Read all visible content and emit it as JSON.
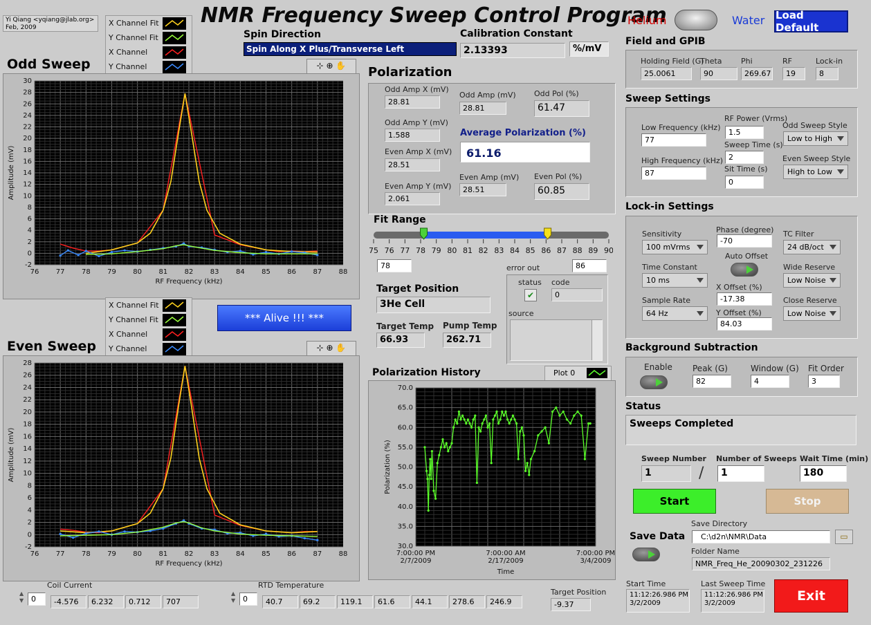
{
  "app": {
    "title": "NMR Frequency Sweep Control Program",
    "author_line1": "Yi Qiang <yqiang@jlab.org>",
    "author_line2": "Feb, 2009",
    "helium_label": "Helium",
    "water_label": "Water",
    "load_default": "Load Default"
  },
  "spin": {
    "label": "Spin Direction",
    "value": "Spin Along X Plus/Transverse Left"
  },
  "calibration": {
    "label": "Calibration Constant",
    "value": "2.13393",
    "unit": "%/mV"
  },
  "odd_sweep": {
    "title": "Odd Sweep",
    "legend": [
      "X Channel Fit",
      "Y Channel Fit",
      "X Channel",
      "Y Channel"
    ],
    "xlabel": "RF Frequency (kHz)",
    "ylabel": "Amplitude (mV)",
    "ticks_x": [
      "76",
      "77",
      "78",
      "79",
      "80",
      "81",
      "82",
      "83",
      "84",
      "85",
      "86",
      "87",
      "88"
    ],
    "ticks_y": [
      "30",
      "28",
      "26",
      "24",
      "22",
      "20",
      "18",
      "16",
      "14",
      "12",
      "10",
      "8",
      "6",
      "4",
      "2",
      "0",
      "-2"
    ]
  },
  "even_sweep": {
    "title": "Even Sweep",
    "legend": [
      "X Channel Fit",
      "Y Channel Fit",
      "X Channel",
      "Y Channel"
    ],
    "xlabel": "RF Frequency (kHz)",
    "ylabel": "Amplitude (mV)",
    "ticks_x": [
      "76",
      "77",
      "78",
      "79",
      "80",
      "81",
      "82",
      "83",
      "84",
      "85",
      "86",
      "87",
      "88"
    ],
    "ticks_y": [
      "28",
      "26",
      "24",
      "22",
      "20",
      "18",
      "16",
      "14",
      "12",
      "10",
      "8",
      "6",
      "4",
      "2",
      "0",
      "-2"
    ]
  },
  "alive": "*** Alive !!! ***",
  "polarization": {
    "title": "Polarization",
    "odd_amp_x_label": "Odd Amp X (mV)",
    "odd_amp_x": "28.81",
    "odd_amp_y_label": "Odd Amp Y (mV)",
    "odd_amp_y": "1.588",
    "even_amp_x_label": "Even Amp X (mV)",
    "even_amp_x": "28.51",
    "even_amp_y_label": "Even Amp Y (mV)",
    "even_amp_y": "2.061",
    "odd_amp_label": "Odd Amp (mV)",
    "odd_amp": "28.81",
    "even_amp_label": "Even Amp (mV)",
    "even_amp": "28.51",
    "odd_pol_label": "Odd Pol (%)",
    "odd_pol": "61.47",
    "even_pol_label": "Even Pol (%)",
    "even_pol": "60.85",
    "avg_label": "Average Polarization (%)",
    "avg": "61.16"
  },
  "fit_range": {
    "label": "Fit Range",
    "ticks": [
      "75",
      "76",
      "77",
      "78",
      "79",
      "80",
      "81",
      "82",
      "83",
      "84",
      "85",
      "86",
      "87",
      "88",
      "89",
      "90"
    ],
    "low": "78",
    "high": "86",
    "low_value": 78.2,
    "high_value": 86.1,
    "min": 75,
    "max": 90
  },
  "error_out": {
    "label": "error out",
    "status_label": "status",
    "code_label": "code",
    "code": "0",
    "source_label": "source",
    "check": "✔"
  },
  "target": {
    "position_label": "Target Position",
    "position": "3He Cell",
    "temp_label": "Target Temp",
    "temp": "66.93",
    "pump_label": "Pump Temp",
    "pump": "262.71"
  },
  "history": {
    "title": "Polarization History",
    "plot_label": "Plot 0",
    "xlabel": "Time",
    "ylabel": "Polarization (%)",
    "ticks_y": [
      "70.0",
      "65.0",
      "60.0",
      "55.0",
      "50.0",
      "45.0",
      "40.0",
      "35.0",
      "30.0"
    ],
    "ticks_x": [
      [
        "7:00:00 PM",
        "2/7/2009"
      ],
      [
        "7:00:00 AM",
        "2/17/2009"
      ],
      [
        "7:00:00 PM",
        "3/4/2009"
      ]
    ]
  },
  "field": {
    "title": "Field and GPIB",
    "holding_label": "Holding Field (G)",
    "holding": "25.0061",
    "theta_label": "Theta",
    "theta": "90",
    "phi_label": "Phi",
    "phi": "269.67",
    "rf_label": "RF",
    "rf": "19",
    "lockin_label": "Lock-in",
    "lockin": "8"
  },
  "sweep_settings": {
    "title": "Sweep Settings",
    "low_label": "Low Frequency (kHz)",
    "low": "77",
    "high_label": "High Frequency (kHz)",
    "high": "87",
    "rf_power_label": "RF Power (Vrms)",
    "rf_power": "1.5",
    "sweep_time_label": "Sweep Time (s)",
    "sweep_time": "2",
    "sit_time_label": "Sit Time (s)",
    "sit_time": "0",
    "odd_style_label": "Odd Sweep Style",
    "odd_style": "Low to High",
    "even_style_label": "Even Sweep Style",
    "even_style": "High to Low"
  },
  "lockin": {
    "title": "Lock-in Settings",
    "sensitivity_label": "Sensitivity",
    "sensitivity": "100 mVrms",
    "time_constant_label": "Time Constant",
    "time_constant": "10 ms",
    "sample_rate_label": "Sample Rate",
    "sample_rate": "64 Hz",
    "phase_label": "Phase (degree)",
    "phase": "-70",
    "auto_offset_label": "Auto Offset",
    "x_offset_label": "X Offset (%)",
    "x_offset": "-17.38",
    "y_offset_label": "Y Offset (%)",
    "y_offset": "84.03",
    "tc_filter_label": "TC Filter",
    "tc_filter": "24 dB/oct",
    "wide_label": "Wide Reserve",
    "wide": "Low Noise",
    "close_label": "Close Reserve",
    "close": "Low Noise"
  },
  "background": {
    "title": "Background Subtraction",
    "enable_label": "Enable",
    "peak_label": "Peak (G)",
    "peak": "82",
    "window_label": "Window (G)",
    "window": "4",
    "fit_order_label": "Fit Order",
    "fit_order": "3"
  },
  "status": {
    "title": "Status",
    "value": "Sweeps Completed"
  },
  "sweeps": {
    "number_label": "Sweep Number",
    "number": "1",
    "count_label": "Number of Sweeps",
    "count": "1",
    "wait_label": "Wait Time (min)",
    "wait": "180",
    "slash": "/"
  },
  "buttons": {
    "start": "Start",
    "stop": "Stop",
    "exit": "Exit"
  },
  "save": {
    "label": "Save Data",
    "dir_label": "Save Directory",
    "dir": "C:\\d2n\\NMR\\Data",
    "folder_label": "Folder Name",
    "folder": "NMR_Freq_He_20090302_231226"
  },
  "times": {
    "start_label": "Start Time",
    "start1": "11:12:26.986 PM",
    "start2": "3/2/2009",
    "last_label": "Last Sweep Time",
    "last1": "11:12:26.986 PM",
    "last2": "3/2/2009"
  },
  "coil": {
    "label": "Coil Current",
    "index": "0",
    "values": [
      "-4.576",
      "6.232",
      "0.712",
      "707"
    ]
  },
  "rtd": {
    "label": "RTD Temperature",
    "index": "0",
    "values": [
      "40.7",
      "69.2",
      "119.1",
      "61.6",
      "44.1",
      "278.6",
      "246.9"
    ]
  },
  "target_position": {
    "label": "Target Position",
    "value": "-9.37"
  },
  "colors": {
    "x_fit": "#ffd21e",
    "y_fit": "#9aff3c",
    "x_ch": "#ff2020",
    "y_ch": "#3a8bff",
    "history": "#5bff2a"
  },
  "chart_data": [
    {
      "type": "line",
      "title": "Odd Sweep",
      "xlabel": "RF Frequency (kHz)",
      "ylabel": "Amplitude (mV)",
      "xlim": [
        76,
        88
      ],
      "ylim": [
        -2,
        30
      ],
      "series": [
        {
          "name": "X Channel Fit",
          "x": [
            78,
            79,
            80,
            80.5,
            81,
            81.3,
            81.6,
            81.85,
            82.1,
            82.4,
            82.7,
            83.2,
            84,
            85,
            86,
            87
          ],
          "y": [
            0,
            0.6,
            1.8,
            3.5,
            7.5,
            12.5,
            21,
            27.8,
            21,
            12.5,
            7.5,
            3.5,
            1.6,
            0.6,
            0.3,
            0.2
          ]
        },
        {
          "name": "Y Channel Fit",
          "x": [
            78,
            79,
            80,
            81,
            81.5,
            81.8,
            82,
            82.5,
            83,
            84,
            85,
            86,
            87
          ],
          "y": [
            -0.2,
            -0.1,
            0.3,
            0.8,
            1.3,
            1.5,
            1.3,
            0.9,
            0.5,
            0.1,
            -0.1,
            -0.1,
            -0.1
          ]
        },
        {
          "name": "X Channel",
          "x": [
            77,
            77.5,
            78,
            78.5,
            79,
            80,
            81,
            81.85,
            83,
            84,
            85,
            85.5,
            86,
            86.5,
            87
          ],
          "y": [
            1.6,
            0.9,
            0.4,
            0.4,
            0.6,
            1.8,
            7.5,
            27.8,
            3.2,
            1.5,
            0.6,
            0.3,
            0.4,
            0.3,
            0.4
          ]
        },
        {
          "name": "Y Channel",
          "x": [
            77,
            77.3,
            77.7,
            78,
            78.5,
            79,
            79.5,
            80,
            80.5,
            81,
            81.5,
            81.8,
            82,
            82.5,
            83,
            83.5,
            84,
            84.5,
            85,
            85.5,
            86,
            86.5,
            87
          ],
          "y": [
            -0.4,
            0.5,
            -0.3,
            0.4,
            -0.5,
            0.2,
            0.5,
            0.3,
            0.6,
            0.9,
            1.2,
            1.7,
            1.2,
            1.0,
            0.6,
            0.2,
            0.4,
            -0.2,
            0.2,
            -0.1,
            0.3,
            0.1,
            -0.3
          ]
        }
      ]
    },
    {
      "type": "line",
      "title": "Even Sweep",
      "xlabel": "RF Frequency (kHz)",
      "ylabel": "Amplitude (mV)",
      "xlim": [
        76,
        88
      ],
      "ylim": [
        -2,
        28
      ],
      "series": [
        {
          "name": "X Channel Fit",
          "x": [
            77,
            78,
            79,
            80,
            80.5,
            81,
            81.3,
            81.6,
            81.85,
            82.1,
            82.4,
            82.7,
            83.2,
            84,
            85,
            86,
            87
          ],
          "y": [
            0.6,
            0.3,
            0.6,
            1.8,
            3.5,
            7.5,
            12.5,
            21,
            27.5,
            21,
            12.5,
            7.5,
            3.5,
            1.6,
            0.6,
            0.3,
            0.5
          ]
        },
        {
          "name": "Y Channel Fit",
          "x": [
            77,
            78,
            79,
            80,
            81,
            81.5,
            81.8,
            82,
            82.5,
            83,
            84,
            85,
            86,
            87
          ],
          "y": [
            -0.2,
            -0.1,
            0.0,
            0.4,
            1.2,
            1.9,
            2.1,
            1.9,
            1.1,
            0.6,
            0.1,
            -0.1,
            -0.2,
            -0.3
          ]
        },
        {
          "name": "X Channel",
          "x": [
            77,
            77.5,
            78,
            78.5,
            79,
            80,
            81,
            81.85,
            83,
            84,
            85,
            86,
            86.5,
            87
          ],
          "y": [
            0.9,
            0.7,
            0.4,
            0.3,
            0.6,
            1.8,
            7.5,
            27.5,
            3.2,
            1.5,
            0.6,
            0.3,
            0.5,
            0.5
          ]
        },
        {
          "name": "Y Channel",
          "x": [
            77,
            77.5,
            78,
            78.5,
            79,
            79.5,
            80,
            80.5,
            81,
            81.5,
            81.8,
            82,
            82.5,
            83,
            83.5,
            84,
            84.5,
            85,
            85.5,
            86,
            86.5,
            87
          ],
          "y": [
            0.1,
            -0.5,
            0.2,
            0.5,
            0.0,
            0.5,
            0.4,
            0.6,
            1.0,
            1.8,
            2.3,
            1.8,
            1.0,
            0.8,
            0.2,
            0.3,
            -0.2,
            0.1,
            -0.3,
            -0.2,
            -0.6,
            -0.9
          ]
        }
      ]
    },
    {
      "type": "line",
      "title": "Polarization History",
      "xlabel": "Time",
      "ylabel": "Polarization (%)",
      "x_ticks": [
        "7:00:00 PM 2/7/2009",
        "7:00:00 AM 2/17/2009",
        "7:00:00 PM 3/4/2009"
      ],
      "ylim": [
        30,
        70
      ],
      "series": [
        {
          "name": "Plot 0",
          "x": [
            0.05,
            0.06,
            0.065,
            0.07,
            0.075,
            0.08,
            0.085,
            0.09,
            0.1,
            0.11,
            0.12,
            0.13,
            0.14,
            0.15,
            0.16,
            0.17,
            0.18,
            0.19,
            0.2,
            0.21,
            0.22,
            0.23,
            0.24,
            0.25,
            0.26,
            0.27,
            0.28,
            0.29,
            0.3,
            0.31,
            0.32,
            0.33,
            0.34,
            0.35,
            0.36,
            0.37,
            0.38,
            0.39,
            0.4,
            0.41,
            0.42,
            0.43,
            0.44,
            0.45,
            0.46,
            0.47,
            0.48,
            0.49,
            0.5,
            0.51,
            0.52,
            0.53,
            0.54,
            0.55,
            0.56,
            0.57,
            0.58,
            0.59,
            0.6,
            0.61,
            0.62,
            0.63,
            0.64,
            0.66,
            0.68,
            0.7,
            0.72,
            0.74,
            0.76,
            0.78,
            0.8,
            0.82,
            0.84,
            0.86,
            0.88,
            0.9,
            0.92,
            0.94,
            0.96,
            0.97
          ],
          "y": [
            55,
            49,
            47,
            39,
            48,
            52,
            47,
            54,
            44,
            42,
            51,
            53,
            55,
            57,
            55,
            56,
            54,
            55,
            56,
            60,
            62,
            61,
            64,
            62,
            63,
            62,
            61,
            62,
            61,
            60,
            62,
            63,
            46,
            60,
            59,
            61,
            62,
            63,
            60,
            61,
            51,
            62,
            63,
            64,
            61,
            62,
            64,
            63,
            64,
            62,
            61,
            62,
            63,
            62,
            61,
            52,
            59,
            60,
            58,
            49,
            51,
            48,
            52,
            54,
            58,
            59,
            60,
            56,
            64,
            65,
            63,
            64,
            62,
            61,
            63,
            64,
            63,
            52,
            61,
            61
          ]
        }
      ]
    }
  ]
}
